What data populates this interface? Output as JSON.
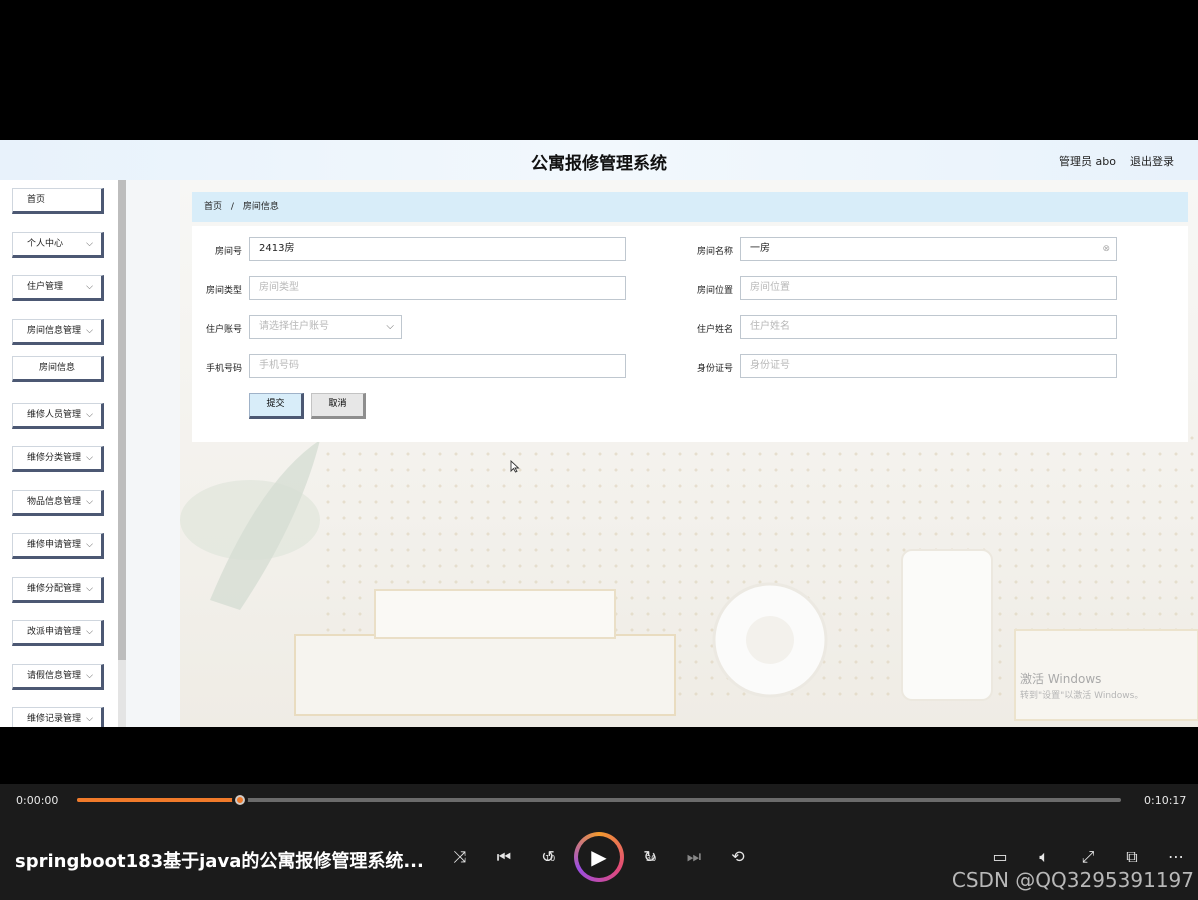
{
  "app": {
    "title": "公寓报修管理系统",
    "user_label": "管理员 abo",
    "logout_label": "退出登录"
  },
  "sidebar": {
    "items": [
      {
        "label": "首页",
        "chevron": false
      },
      {
        "label": "个人中心",
        "chevron": true
      },
      {
        "label": "住户管理",
        "chevron": true
      },
      {
        "label": "房间信息管理",
        "chevron": true
      },
      {
        "label": "房间信息",
        "chevron": false,
        "sub": true
      },
      {
        "label": "维修人员管理",
        "chevron": true
      },
      {
        "label": "维修分类管理",
        "chevron": true
      },
      {
        "label": "物品信息管理",
        "chevron": true
      },
      {
        "label": "维修申请管理",
        "chevron": true
      },
      {
        "label": "维修分配管理",
        "chevron": true
      },
      {
        "label": "改派申请管理",
        "chevron": true
      },
      {
        "label": "请假信息管理",
        "chevron": true
      },
      {
        "label": "维修记录管理",
        "chevron": true
      }
    ]
  },
  "breadcrumb": {
    "home": "首页",
    "separator": "/",
    "current": "房间信息"
  },
  "form": {
    "room_no": {
      "label": "房间号",
      "value": "2413房"
    },
    "room_name": {
      "label": "房间名称",
      "value": "一房"
    },
    "room_type": {
      "label": "房间类型",
      "placeholder": "房间类型"
    },
    "room_location": {
      "label": "房间位置",
      "placeholder": "房间位置"
    },
    "resident_account": {
      "label": "住户账号",
      "placeholder": "请选择住户账号"
    },
    "resident_name": {
      "label": "住户姓名",
      "placeholder": "住户姓名"
    },
    "phone": {
      "label": "手机号码",
      "placeholder": "手机号码"
    },
    "id_no": {
      "label": "身份证号",
      "placeholder": "身份证号"
    },
    "submit_label": "提交",
    "cancel_label": "取消"
  },
  "windows_watermark": {
    "line1": "激活 Windows",
    "line2": "转到\"设置\"以激活 Windows。"
  },
  "player": {
    "current_time": "0:00:00",
    "total_time": "0:10:17",
    "progress": 0.156,
    "video_title": "springboot183基于java的公寓报修管理系统...",
    "skip_back_label": "10",
    "skip_forward_label": "30",
    "accent_color": "#f07a2a"
  },
  "watermark": "CSDN @QQ3295391197"
}
